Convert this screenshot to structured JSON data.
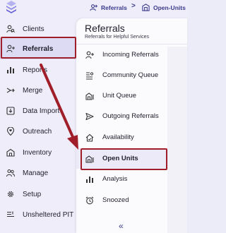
{
  "colors": {
    "accent": "#3b3a8c",
    "highlight": "#a01e29",
    "sidebar_bg": "#eeedf9",
    "panel_bg": "#fbfbfe"
  },
  "topbar": {
    "logo_icon": "layers-logo-icon",
    "breadcrumb": [
      {
        "label": "Referrals",
        "icon": "referrals-icon"
      },
      {
        "label": "Open-Units",
        "icon": "units-icon"
      }
    ],
    "separator": ">"
  },
  "sidebar": {
    "items": [
      {
        "label": "Clients",
        "icon": "search-person-icon"
      },
      {
        "label": "Referrals",
        "icon": "person-plus-icon",
        "active": true
      },
      {
        "label": "Reports",
        "icon": "bar-chart-icon"
      },
      {
        "label": "Merge",
        "icon": "merge-icon"
      },
      {
        "label": "Data Import",
        "icon": "import-icon"
      },
      {
        "label": "Outreach",
        "icon": "location-heart-icon"
      },
      {
        "label": "Inventory",
        "icon": "building-icon"
      },
      {
        "label": "Manage",
        "icon": "people-icon"
      },
      {
        "label": "Setup",
        "icon": "gear-icon"
      },
      {
        "label": "Unsheltered PIT",
        "icon": "list-icon"
      }
    ]
  },
  "panel": {
    "title": "Referrals",
    "subtitle": "Referrals for Helpful Services",
    "items": [
      {
        "label": "Incoming Referrals",
        "icon": "person-plus-icon"
      },
      {
        "label": "Community Queue",
        "icon": "queue-icon"
      },
      {
        "label": "Unit Queue",
        "icon": "unit-queue-icon"
      },
      {
        "label": "Outgoing Referrals",
        "icon": "send-icon"
      },
      {
        "label": "Availability",
        "icon": "home-check-icon"
      },
      {
        "label": "Open Units",
        "icon": "open-units-icon",
        "active": true
      },
      {
        "label": "Analysis",
        "icon": "bar-chart-icon"
      },
      {
        "label": "Snoozed",
        "icon": "alarm-icon"
      }
    ],
    "collapse_label": "«"
  }
}
